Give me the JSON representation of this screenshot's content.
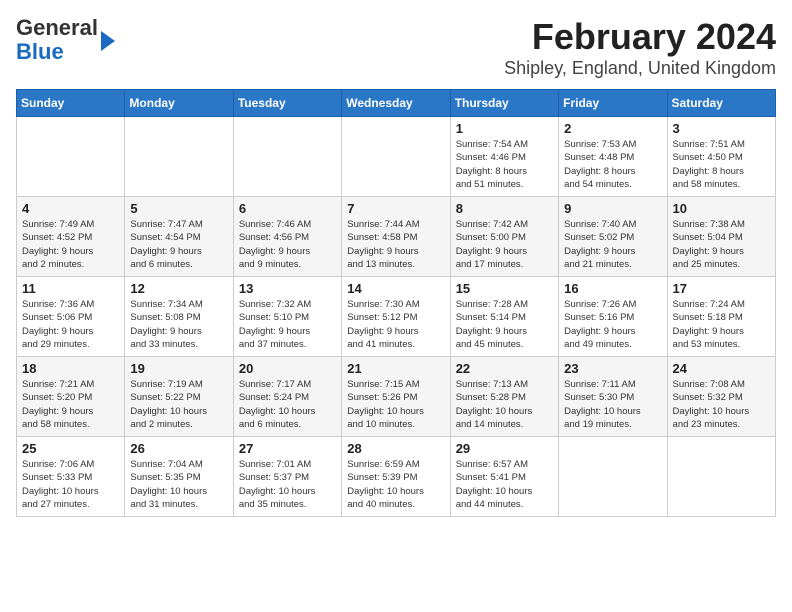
{
  "logo": {
    "general": "General",
    "blue": "Blue"
  },
  "title": "February 2024",
  "subtitle": "Shipley, England, United Kingdom",
  "days_of_week": [
    "Sunday",
    "Monday",
    "Tuesday",
    "Wednesday",
    "Thursday",
    "Friday",
    "Saturday"
  ],
  "weeks": [
    [
      {
        "day": "",
        "info": ""
      },
      {
        "day": "",
        "info": ""
      },
      {
        "day": "",
        "info": ""
      },
      {
        "day": "",
        "info": ""
      },
      {
        "day": "1",
        "info": "Sunrise: 7:54 AM\nSunset: 4:46 PM\nDaylight: 8 hours\nand 51 minutes."
      },
      {
        "day": "2",
        "info": "Sunrise: 7:53 AM\nSunset: 4:48 PM\nDaylight: 8 hours\nand 54 minutes."
      },
      {
        "day": "3",
        "info": "Sunrise: 7:51 AM\nSunset: 4:50 PM\nDaylight: 8 hours\nand 58 minutes."
      }
    ],
    [
      {
        "day": "4",
        "info": "Sunrise: 7:49 AM\nSunset: 4:52 PM\nDaylight: 9 hours\nand 2 minutes."
      },
      {
        "day": "5",
        "info": "Sunrise: 7:47 AM\nSunset: 4:54 PM\nDaylight: 9 hours\nand 6 minutes."
      },
      {
        "day": "6",
        "info": "Sunrise: 7:46 AM\nSunset: 4:56 PM\nDaylight: 9 hours\nand 9 minutes."
      },
      {
        "day": "7",
        "info": "Sunrise: 7:44 AM\nSunset: 4:58 PM\nDaylight: 9 hours\nand 13 minutes."
      },
      {
        "day": "8",
        "info": "Sunrise: 7:42 AM\nSunset: 5:00 PM\nDaylight: 9 hours\nand 17 minutes."
      },
      {
        "day": "9",
        "info": "Sunrise: 7:40 AM\nSunset: 5:02 PM\nDaylight: 9 hours\nand 21 minutes."
      },
      {
        "day": "10",
        "info": "Sunrise: 7:38 AM\nSunset: 5:04 PM\nDaylight: 9 hours\nand 25 minutes."
      }
    ],
    [
      {
        "day": "11",
        "info": "Sunrise: 7:36 AM\nSunset: 5:06 PM\nDaylight: 9 hours\nand 29 minutes."
      },
      {
        "day": "12",
        "info": "Sunrise: 7:34 AM\nSunset: 5:08 PM\nDaylight: 9 hours\nand 33 minutes."
      },
      {
        "day": "13",
        "info": "Sunrise: 7:32 AM\nSunset: 5:10 PM\nDaylight: 9 hours\nand 37 minutes."
      },
      {
        "day": "14",
        "info": "Sunrise: 7:30 AM\nSunset: 5:12 PM\nDaylight: 9 hours\nand 41 minutes."
      },
      {
        "day": "15",
        "info": "Sunrise: 7:28 AM\nSunset: 5:14 PM\nDaylight: 9 hours\nand 45 minutes."
      },
      {
        "day": "16",
        "info": "Sunrise: 7:26 AM\nSunset: 5:16 PM\nDaylight: 9 hours\nand 49 minutes."
      },
      {
        "day": "17",
        "info": "Sunrise: 7:24 AM\nSunset: 5:18 PM\nDaylight: 9 hours\nand 53 minutes."
      }
    ],
    [
      {
        "day": "18",
        "info": "Sunrise: 7:21 AM\nSunset: 5:20 PM\nDaylight: 9 hours\nand 58 minutes."
      },
      {
        "day": "19",
        "info": "Sunrise: 7:19 AM\nSunset: 5:22 PM\nDaylight: 10 hours\nand 2 minutes."
      },
      {
        "day": "20",
        "info": "Sunrise: 7:17 AM\nSunset: 5:24 PM\nDaylight: 10 hours\nand 6 minutes."
      },
      {
        "day": "21",
        "info": "Sunrise: 7:15 AM\nSunset: 5:26 PM\nDaylight: 10 hours\nand 10 minutes."
      },
      {
        "day": "22",
        "info": "Sunrise: 7:13 AM\nSunset: 5:28 PM\nDaylight: 10 hours\nand 14 minutes."
      },
      {
        "day": "23",
        "info": "Sunrise: 7:11 AM\nSunset: 5:30 PM\nDaylight: 10 hours\nand 19 minutes."
      },
      {
        "day": "24",
        "info": "Sunrise: 7:08 AM\nSunset: 5:32 PM\nDaylight: 10 hours\nand 23 minutes."
      }
    ],
    [
      {
        "day": "25",
        "info": "Sunrise: 7:06 AM\nSunset: 5:33 PM\nDaylight: 10 hours\nand 27 minutes."
      },
      {
        "day": "26",
        "info": "Sunrise: 7:04 AM\nSunset: 5:35 PM\nDaylight: 10 hours\nand 31 minutes."
      },
      {
        "day": "27",
        "info": "Sunrise: 7:01 AM\nSunset: 5:37 PM\nDaylight: 10 hours\nand 35 minutes."
      },
      {
        "day": "28",
        "info": "Sunrise: 6:59 AM\nSunset: 5:39 PM\nDaylight: 10 hours\nand 40 minutes."
      },
      {
        "day": "29",
        "info": "Sunrise: 6:57 AM\nSunset: 5:41 PM\nDaylight: 10 hours\nand 44 minutes."
      },
      {
        "day": "",
        "info": ""
      },
      {
        "day": "",
        "info": ""
      }
    ]
  ]
}
